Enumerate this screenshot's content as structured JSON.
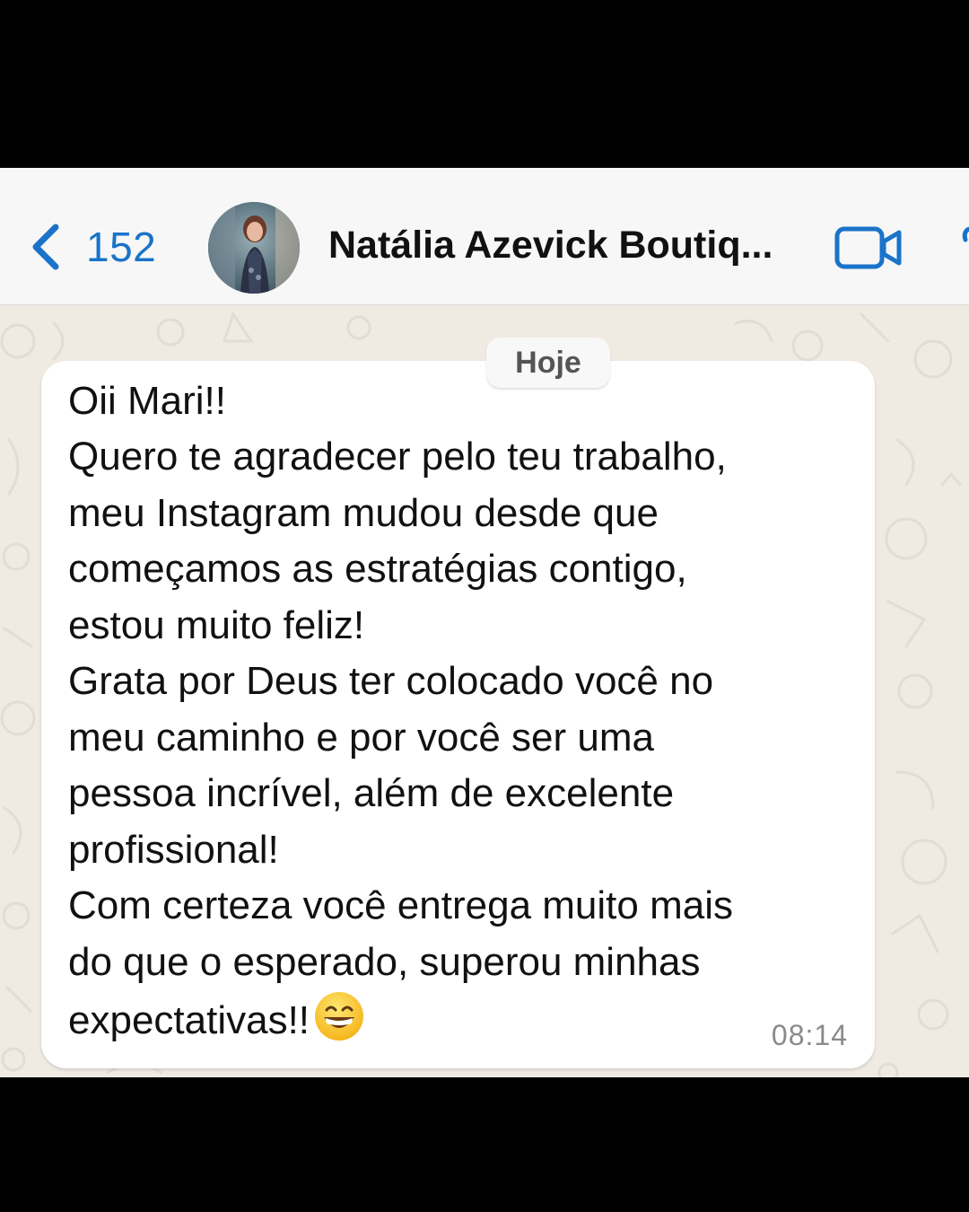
{
  "header": {
    "back_count": "152",
    "contact_name": "Natália Azevick Boutiq...",
    "avatar": "contact-avatar-photo",
    "icons": [
      "chevron-left-icon",
      "video-camera-icon",
      "phone-icon"
    ]
  },
  "chat": {
    "date_separator": "Hoje",
    "message": {
      "lines": [
        "Oii Mari!!",
        "Quero te agradecer pelo teu trabalho,",
        "meu Instagram mudou desde que",
        "começamos as estratégias contigo,",
        "estou muito feliz!",
        "Grata por Deus ter colocado você no",
        "meu caminho e por você ser uma",
        "pessoa incrível, além de excelente",
        "profissional!",
        "Com certeza você entrega muito mais",
        "do que o esperado, superou minhas",
        "expectativas!!"
      ],
      "emoji": "grinning-face-emoji",
      "time": "08:14"
    }
  },
  "colors": {
    "accent": "#1a73c9",
    "chat_background": "#efeae2",
    "bubble": "#ffffff",
    "header": "#f7f7f7"
  }
}
